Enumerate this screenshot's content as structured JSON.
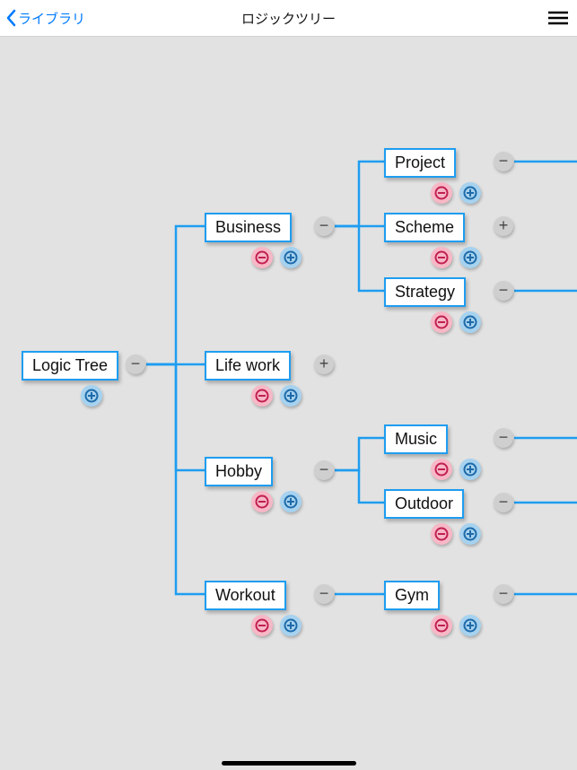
{
  "header": {
    "back_label": "ライブラリ",
    "title": "ロジックツリー"
  },
  "nodes": {
    "root": {
      "label": "Logic Tree"
    },
    "business": {
      "label": "Business"
    },
    "lifework": {
      "label": "Life work"
    },
    "hobby": {
      "label": "Hobby"
    },
    "workout": {
      "label": "Workout"
    },
    "project": {
      "label": "Project"
    },
    "scheme": {
      "label": "Scheme"
    },
    "strategy": {
      "label": "Strategy"
    },
    "music": {
      "label": "Music"
    },
    "outdoor": {
      "label": "Outdoor"
    },
    "gym": {
      "label": "Gym"
    }
  },
  "glyphs": {
    "minus": "−",
    "plus": "+"
  }
}
